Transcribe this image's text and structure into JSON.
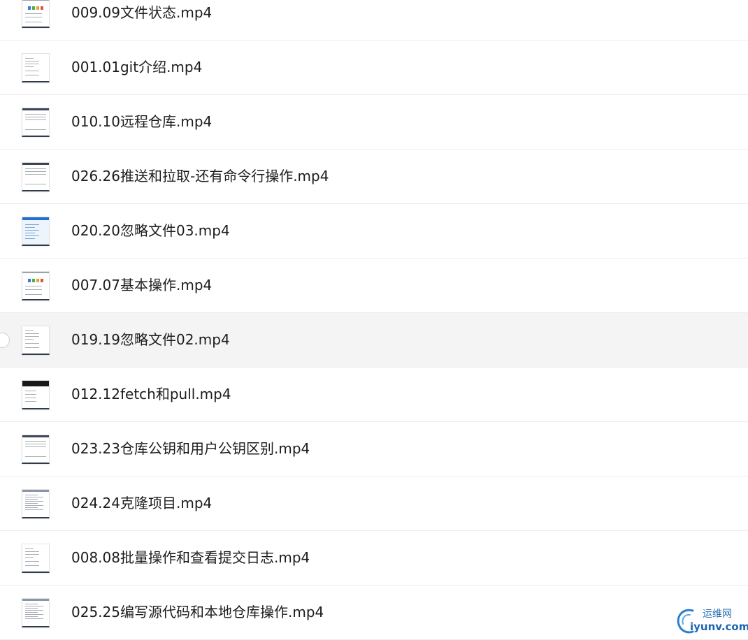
{
  "files": [
    {
      "name": "009.09文件状态.mp4",
      "thumb": "slide-colors"
    },
    {
      "name": "001.01git介绍.mp4",
      "thumb": "slide-text"
    },
    {
      "name": "010.10远程仓库.mp4",
      "thumb": "slide-window"
    },
    {
      "name": "026.26推送和拉取-还有命令行操作.mp4",
      "thumb": "slide-window"
    },
    {
      "name": "020.20忽略文件03.mp4",
      "thumb": "slide-blue"
    },
    {
      "name": "007.07基本操作.mp4",
      "thumb": "slide-colors"
    },
    {
      "name": "019.19忽略文件02.mp4",
      "thumb": "slide-text",
      "hover": true
    },
    {
      "name": "012.12fetch和pull.mp4",
      "thumb": "slide-dark"
    },
    {
      "name": "023.23仓库公钥和用户公钥区别.mp4",
      "thumb": "slide-window"
    },
    {
      "name": "024.24克隆项目.mp4",
      "thumb": "slide-table"
    },
    {
      "name": "008.08批量操作和查看提交日志.mp4",
      "thumb": "slide-text"
    },
    {
      "name": "025.25编写源代码和本地仓库操作.mp4",
      "thumb": "slide-table"
    }
  ],
  "watermark": {
    "top": "运维网",
    "bottom": "iyunv.com"
  }
}
